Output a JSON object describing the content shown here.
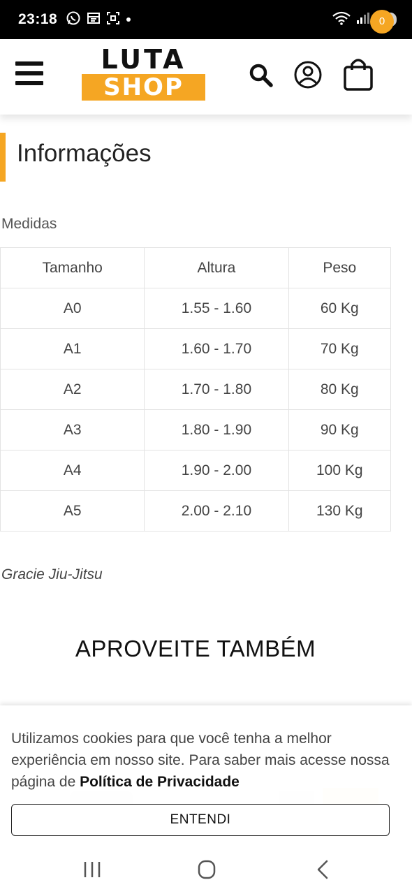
{
  "status_bar": {
    "time": "23:18",
    "battery": "23",
    "icons": [
      "whatsapp-icon",
      "calendar-icon",
      "screenshot-icon",
      "dot-icon",
      "wifi-icon",
      "signal-icon"
    ]
  },
  "header": {
    "logo_top": "LUTA",
    "logo_bottom": "SHOP",
    "cart_count": "0",
    "icons": [
      "menu-icon",
      "search-icon",
      "account-icon",
      "cart-icon"
    ]
  },
  "section": {
    "title": "Informações",
    "subtitle": "Medidas"
  },
  "size_table": {
    "headers": [
      "Tamanho",
      "Altura",
      "Peso"
    ],
    "rows": [
      [
        "A0",
        "1.55 - 1.60",
        "60 Kg"
      ],
      [
        "A1",
        "1.60 - 1.70",
        "70 Kg"
      ],
      [
        "A2",
        "1.70 - 1.80",
        "80 Kg"
      ],
      [
        "A3",
        "1.80 - 1.90",
        "90 Kg"
      ],
      [
        "A4",
        "1.90 - 2.00",
        "100 Kg"
      ],
      [
        "A5",
        "2.00 - 2.10",
        "130 Kg"
      ]
    ]
  },
  "brand_note": "Gracie Jiu-Jitsu",
  "related_title": "APROVEITE TAMBÉM",
  "cookie": {
    "text": "Utilizamos cookies para que você tenha a melhor experiência em nosso site. Para saber mais acesse nossa página de ",
    "link": "Política de Privacidade",
    "button": "ENTENDI"
  },
  "nav_bar": {
    "icons": [
      "recent-apps-icon",
      "home-icon",
      "back-icon"
    ]
  },
  "colors": {
    "accent": "#f5a623",
    "text": "#222222",
    "border": "#e3e3e3"
  }
}
